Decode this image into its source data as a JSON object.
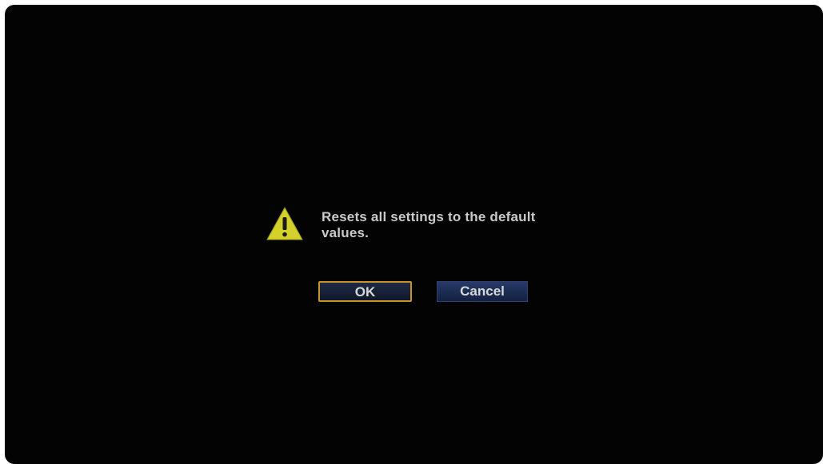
{
  "dialog": {
    "icon": "warning-triangle-icon",
    "message": "Resets all settings to the default values.",
    "buttons": {
      "ok_label": "OK",
      "cancel_label": "Cancel"
    },
    "focused_button": "OK"
  },
  "colors": {
    "background": "#030303",
    "text": "#c9c9c9",
    "focus_border": "#c9922c",
    "button_fill": "#1a2a50",
    "warning_icon": "#d4d12a"
  }
}
